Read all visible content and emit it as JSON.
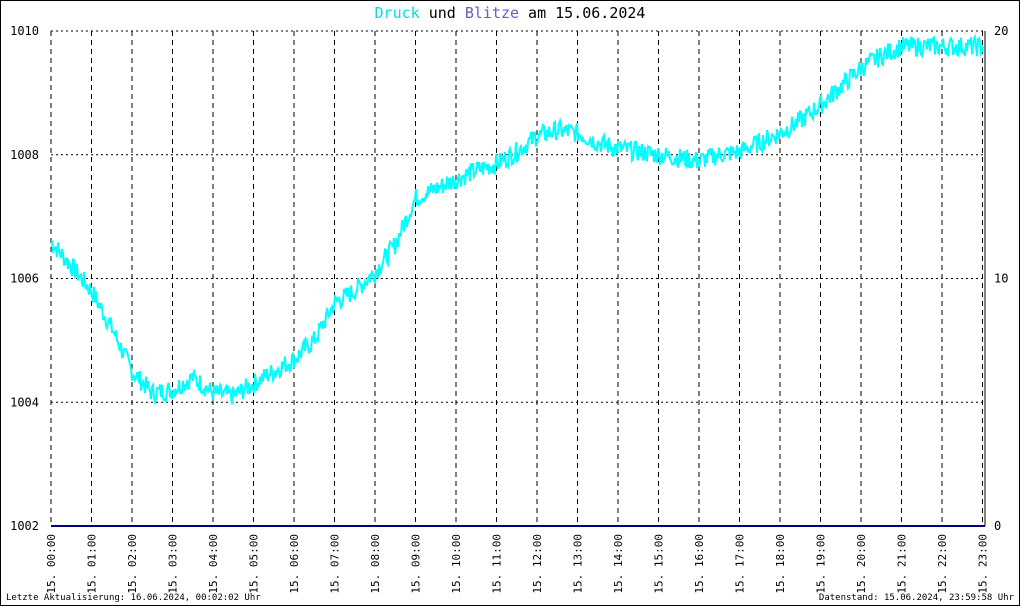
{
  "title": {
    "part1": "Druck",
    "part2": " und ",
    "part3": "Blitze",
    "part4": " am 15.06.2024"
  },
  "colors": {
    "pressure": "#00ffff",
    "lightning": "#000080",
    "title_druck": "#00e0e0",
    "title_blitze": "#6a5acd",
    "grid": "#000000"
  },
  "footer": {
    "left": "Letzte Aktualisierung: 16.06.2024, 00:02:02 Uhr",
    "right": "Datenstand: 15.06.2024, 23:59:58 Uhr"
  },
  "chart_data": {
    "type": "line",
    "title": "Druck und Blitze am 15.06.2024",
    "y_left": {
      "min": 1002,
      "max": 1010,
      "ticks": [
        "1002",
        "1004",
        "1006",
        "1008",
        "1010"
      ]
    },
    "y_right": {
      "min": 0,
      "max": 20,
      "ticks": [
        "0",
        "10",
        "20"
      ]
    },
    "x_ticks": [
      "15. 00:00",
      "15. 01:00",
      "15. 02:00",
      "15. 03:00",
      "15. 04:00",
      "15. 05:00",
      "15. 06:00",
      "15. 07:00",
      "15. 08:00",
      "15. 09:00",
      "15. 10:00",
      "15. 11:00",
      "15. 12:00",
      "15. 13:00",
      "15. 14:00",
      "15. 15:00",
      "15. 16:00",
      "15. 17:00",
      "15. 18:00",
      "15. 19:00",
      "15. 20:00",
      "15. 21:00",
      "15. 22:00",
      "15. 23:00"
    ],
    "grid": true,
    "series": [
      {
        "name": "Druck",
        "axis": "left",
        "x_hours": [
          0,
          0.5,
          1,
          1.5,
          2,
          2.5,
          3,
          3.5,
          4,
          4.5,
          5,
          5.5,
          6,
          6.5,
          7,
          7.5,
          8,
          8.5,
          9,
          9.5,
          10,
          10.5,
          11,
          11.5,
          12,
          12.5,
          13,
          13.5,
          14,
          14.5,
          15,
          15.5,
          16,
          16.5,
          17,
          17.5,
          18,
          18.5,
          19,
          19.5,
          20,
          20.5,
          21,
          21.5,
          22,
          22.5,
          23,
          23.5,
          24
        ],
        "values": [
          1006.6,
          1006.2,
          1005.8,
          1005.2,
          1004.5,
          1004.15,
          1004.2,
          1004.4,
          1004.15,
          1004.1,
          1004.3,
          1004.5,
          1004.7,
          1005.0,
          1005.6,
          1005.8,
          1006.1,
          1006.55,
          1007.3,
          1007.45,
          1007.6,
          1007.75,
          1007.85,
          1008.05,
          1008.3,
          1008.4,
          1008.35,
          1008.2,
          1008.1,
          1008.05,
          1008.0,
          1007.95,
          1007.9,
          1008.0,
          1008.05,
          1008.2,
          1008.35,
          1008.55,
          1008.8,
          1009.1,
          1009.4,
          1009.6,
          1009.75
        ]
      },
      {
        "name": "Blitze",
        "axis": "right",
        "x_hours": [
          0,
          24
        ],
        "values": [
          0,
          0
        ]
      }
    ]
  }
}
